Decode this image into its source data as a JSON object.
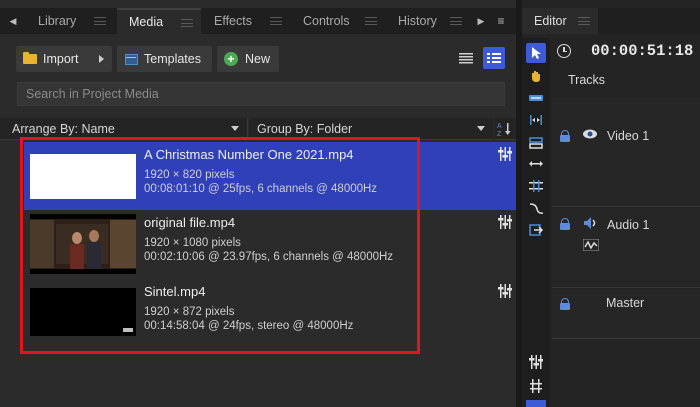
{
  "tabs": {
    "items": [
      {
        "label": "Library"
      },
      {
        "label": "Media"
      },
      {
        "label": "Effects"
      },
      {
        "label": "Controls"
      },
      {
        "label": "History"
      }
    ],
    "active": "Media"
  },
  "toolbar": {
    "import_label": "Import",
    "templates_label": "Templates",
    "new_label": "New"
  },
  "search": {
    "placeholder": "Search in Project Media"
  },
  "sort": {
    "arrange_label": "Arrange By: Name",
    "group_label": "Group By: Folder",
    "az_label": "A Z"
  },
  "media": [
    {
      "title": "A Christmas Number One 2021.mp4",
      "dimensions": "1920 × 820 pixels",
      "details": "00:08:01:10 @ 25fps, 6 channels @ 48000Hz",
      "selected": true
    },
    {
      "title": "original file.mp4",
      "dimensions": "1920 × 1080 pixels",
      "details": "00:02:10:06 @ 23.97fps, 6 channels @ 48000Hz",
      "selected": false
    },
    {
      "title": "Sintel.mp4",
      "dimensions": "1920 × 872 pixels",
      "details": "00:14:58:04 @ 24fps, stereo @ 48000Hz",
      "selected": false
    }
  ],
  "editor": {
    "tab_label": "Editor",
    "timecode": "00:00:51:18",
    "tracks_label": "Tracks",
    "tracks": [
      {
        "name": "Video 1",
        "icon": "eye-icon"
      },
      {
        "name": "Audio 1",
        "icon": "speaker-icon"
      },
      {
        "name": "Master",
        "icon": ""
      }
    ]
  },
  "colors": {
    "accent": "#3d5bd9",
    "selection": "#3040b8",
    "highlight_box": "#e0161c",
    "folder": "#e8b430",
    "new_button": "#4caa55"
  }
}
